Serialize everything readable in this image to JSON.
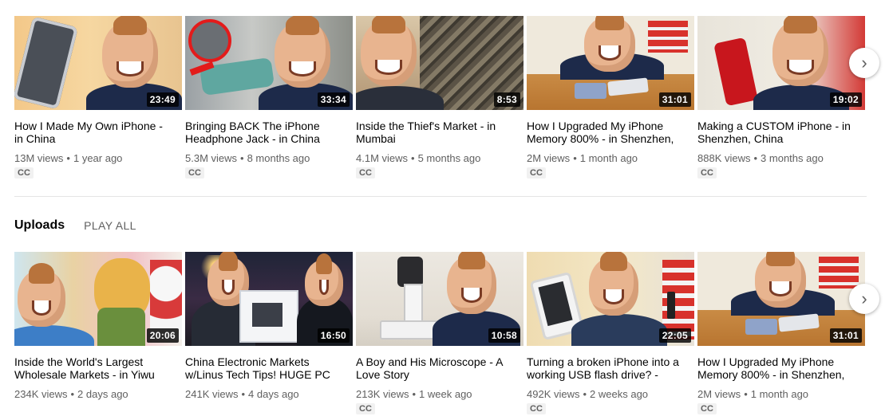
{
  "row1": [
    {
      "title": "How I Made My Own iPhone - in China",
      "duration": "23:49",
      "views": "13M views",
      "age": "1 year ago",
      "badge": "CC"
    },
    {
      "title": "Bringing BACK The iPhone Headphone Jack - in China",
      "duration": "33:34",
      "views": "5.3M views",
      "age": "8 months ago",
      "badge": "CC"
    },
    {
      "title": "Inside the Thief's Market - in Mumbai",
      "duration": "8:53",
      "views": "4.1M views",
      "age": "5 months ago",
      "badge": "CC"
    },
    {
      "title": "How I Upgraded My iPhone Memory 800% - in Shenzhen,",
      "duration": "31:01",
      "views": "2M views",
      "age": "1 month ago",
      "badge": "CC"
    },
    {
      "title": "Making a CUSTOM iPhone - in Shenzhen, China",
      "duration": "19:02",
      "views": "888K views",
      "age": "3 months ago",
      "badge": "CC"
    }
  ],
  "uploads": {
    "title": "Uploads",
    "play_all": "PLAY ALL"
  },
  "row2": [
    {
      "title": "Inside the World's Largest Wholesale Markets - in Yiwu",
      "duration": "20:06",
      "views": "234K views",
      "age": "2 days ago",
      "badge": ""
    },
    {
      "title": "China Electronic Markets w/Linus Tech Tips! HUGE PC",
      "duration": "16:50",
      "views": "241K views",
      "age": "4 days ago",
      "badge": ""
    },
    {
      "title": "A Boy and His Microscope - A Love Story",
      "duration": "10:58",
      "views": "213K views",
      "age": "1 week ago",
      "badge": "CC"
    },
    {
      "title": "Turning a broken iPhone into a working USB flash drive? -",
      "duration": "22:05",
      "views": "492K views",
      "age": "2 weeks ago",
      "badge": "CC"
    },
    {
      "title": "How I Upgraded My iPhone Memory 800% - in Shenzhen,",
      "duration": "31:01",
      "views": "2M views",
      "age": "1 month ago",
      "badge": "CC"
    }
  ],
  "meta_separator": "•",
  "icons": {
    "next": "chevron-right-icon"
  },
  "colors": {
    "meta_text": "#606060",
    "duration_bg": "#000000",
    "divider": "#e5e5e5"
  }
}
